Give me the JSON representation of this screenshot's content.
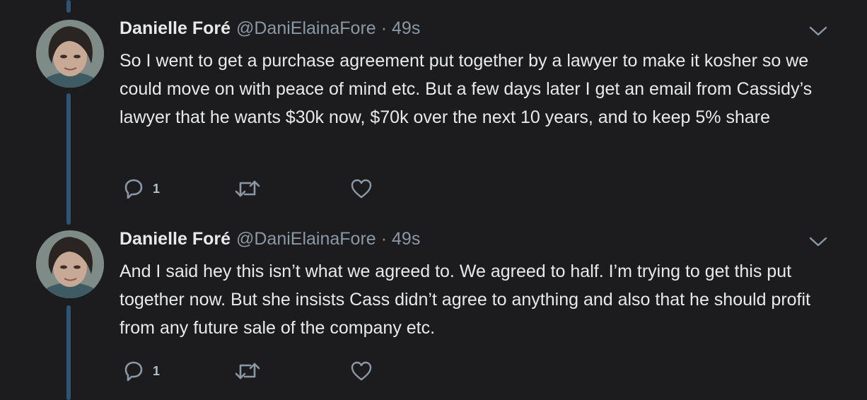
{
  "tweets": [
    {
      "author_name": "Danielle Foré",
      "handle": "@DaniElainaFore",
      "separator": "·",
      "time": "49s",
      "text": "So I went to get a purchase agreement put together by a lawyer to make it kosher so we could move on with peace of mind etc. But a few days later I get an email from Cassidy’s lawyer that he wants $30k now, $70k over the next 10 years, and to keep 5% share",
      "reply_count": "1"
    },
    {
      "author_name": "Danielle Foré",
      "handle": "@DaniElainaFore",
      "separator": "·",
      "time": "49s",
      "text": "And I said hey this isn’t what we agreed to. We agreed to half. I’m trying to get this put together now. But she insists Cass didn’t agree to anything and also that he should profit from any future sale of the company etc.",
      "reply_count": "1"
    }
  ],
  "icons": {
    "reply": "reply-icon",
    "retweet": "retweet-icon",
    "like": "like-icon",
    "caret": "chevron-down-icon"
  },
  "colors": {
    "background": "#1c1c1e",
    "thread_line": "#2f5472",
    "secondary_text": "#8b98a5",
    "icon": "#8b98a5"
  }
}
